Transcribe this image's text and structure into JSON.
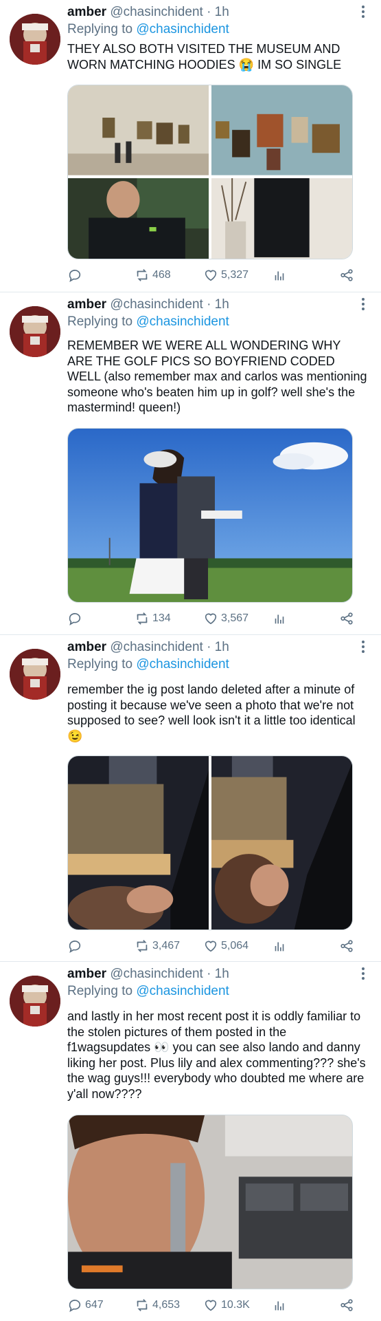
{
  "tweets": [
    {
      "name": "amber",
      "handle": "@chasinchident",
      "time": "· 1h",
      "reply_prefix": "Replying to",
      "reply_to": "@chasinchident",
      "text": "THEY ALSO BOTH VISITED THE MUSEUM AND WORN MATCHING HOODIES 😭 IM SO SINGLE",
      "replies": "",
      "retweets": "468",
      "likes": "5,327"
    },
    {
      "name": "amber",
      "handle": "@chasinchident",
      "time": "· 1h",
      "reply_prefix": "Replying to",
      "reply_to": "@chasinchident",
      "text": "REMEMBER WE WERE ALL WONDERING WHY ARE THE GOLF PICS SO BOYFRIEND CODED WELL (also remember max and carlos was mentioning someone who's beaten him up in golf? well she's the mastermind! queen!)",
      "replies": "",
      "retweets": "134",
      "likes": "3,567"
    },
    {
      "name": "amber",
      "handle": "@chasinchident",
      "time": "· 1h",
      "reply_prefix": "Replying to",
      "reply_to": "@chasinchident",
      "text": "remember the ig post lando deleted after a minute of posting it because we've seen a photo that we're not supposed to see? well look isn't it a little too identical 😉",
      "replies": "",
      "retweets": "3,467",
      "likes": "5,064"
    },
    {
      "name": "amber",
      "handle": "@chasinchident",
      "time": "· 1h",
      "reply_prefix": "Replying to",
      "reply_to": "@chasinchident",
      "text": "and lastly in her most recent post it is oddly familiar to the stolen pictures of them posted in the f1wagsupdates 👀 you can see also lando and danny liking her post. Plus lily and alex commenting??? she's the wag guys!!! everybody who doubted me where are y'all now????",
      "replies": "647",
      "retweets": "4,653",
      "likes": "10.3K"
    }
  ],
  "icons": {
    "reply": "reply-icon",
    "retweet": "retweet-icon",
    "like": "heart-icon",
    "analytics": "analytics-icon",
    "share": "share-icon",
    "more": "more-icon"
  },
  "colors": {
    "link": "#1b95e0",
    "secondary": "#5b7083",
    "divider": "#e1e8ed"
  }
}
